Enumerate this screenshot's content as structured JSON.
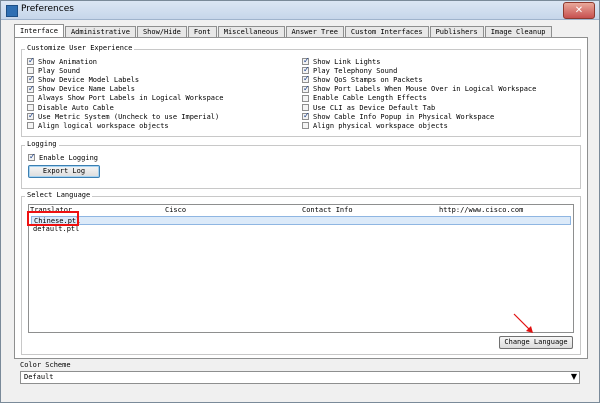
{
  "window": {
    "title": "Preferences",
    "close_glyph": "✕"
  },
  "tabs": [
    {
      "label": "Interface",
      "active": true
    },
    {
      "label": "Administrative"
    },
    {
      "label": "Show/Hide"
    },
    {
      "label": "Font"
    },
    {
      "label": "Miscellaneous"
    },
    {
      "label": "Answer Tree"
    },
    {
      "label": "Custom Interfaces"
    },
    {
      "label": "Publishers"
    },
    {
      "label": "Image Cleanup"
    }
  ],
  "customize": {
    "label": "Customize User Experience",
    "left": [
      {
        "label": "Show Animation",
        "checked": true
      },
      {
        "label": "Play Sound",
        "checked": false
      },
      {
        "label": "Show Device Model Labels",
        "checked": true
      },
      {
        "label": "Show Device Name Labels",
        "checked": true
      },
      {
        "label": "Always Show Port Labels in Logical Workspace",
        "checked": false
      },
      {
        "label": "Disable Auto Cable",
        "checked": false
      },
      {
        "label": "Use Metric System (Uncheck to use Imperial)",
        "checked": true
      },
      {
        "label": "Align logical workspace objects",
        "checked": false
      }
    ],
    "right": [
      {
        "label": "Show Link Lights",
        "checked": true
      },
      {
        "label": "Play Telephony Sound",
        "checked": true
      },
      {
        "label": "Show QoS Stamps on Packets",
        "checked": true
      },
      {
        "label": "Show Port Labels When Mouse Over in Logical Workspace",
        "checked": true
      },
      {
        "label": "Enable Cable Length Effects",
        "checked": false
      },
      {
        "label": "Use CLI as Device Default Tab",
        "checked": false
      },
      {
        "label": "Show Cable Info Popup in Physical Workspace",
        "checked": true
      },
      {
        "label": "Align physical workspace objects",
        "checked": false
      }
    ]
  },
  "logging": {
    "label": "Logging",
    "enable_label": "Enable Logging",
    "enable_checked": true,
    "export_label": "Export Log"
  },
  "language": {
    "label": "Select Language",
    "columns": [
      "Translator",
      "Cisco",
      "Contact Info",
      "http://www.cisco.com"
    ],
    "rows": [
      "Chinese.ptl",
      "default.ptl"
    ],
    "change_label": "Change Language"
  },
  "color_scheme": {
    "label": "Color Scheme",
    "value": "Default",
    "arrow_glyph": "▼"
  },
  "colors": {
    "highlight": "#e11111",
    "selection": "#dceaf9"
  }
}
